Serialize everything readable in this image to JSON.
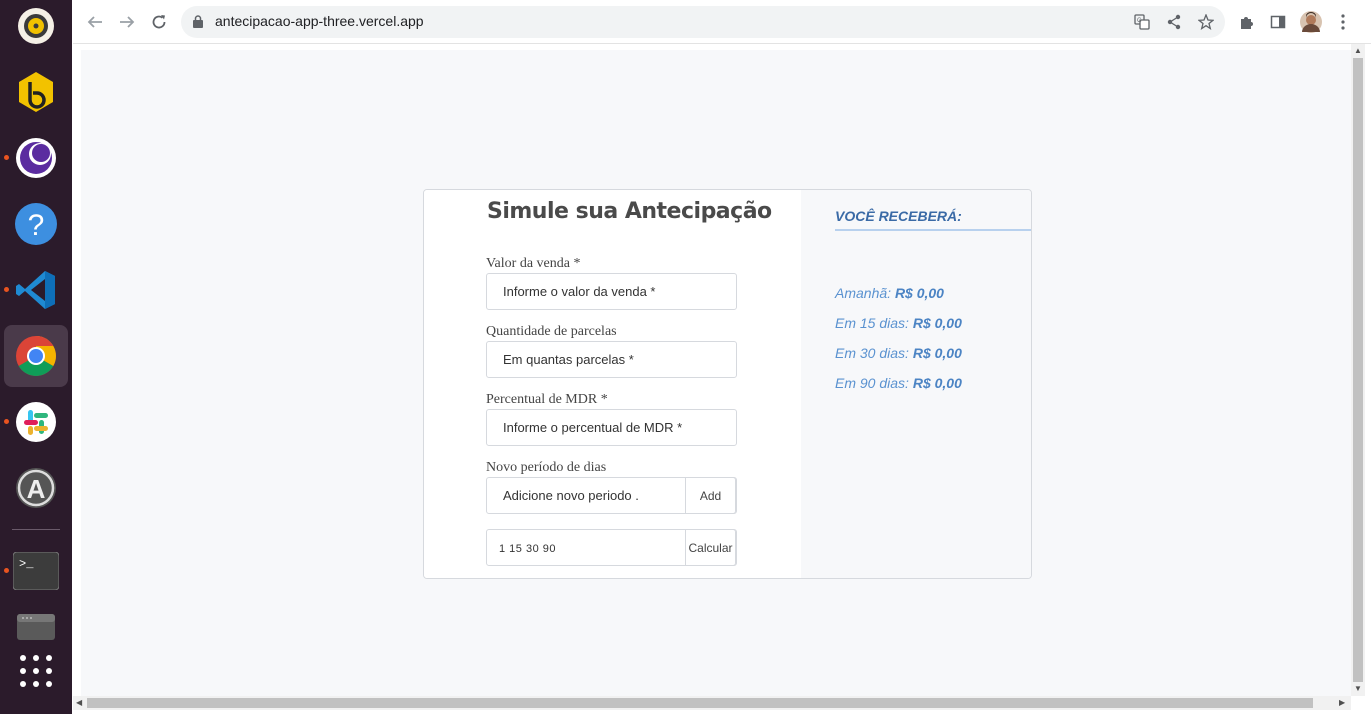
{
  "browser": {
    "url": "antecipacao-app-three.vercel.app"
  },
  "dock": {
    "apps": [
      "rhythmbox-icon",
      "bitwarden-icon",
      "firefox-nightly-icon",
      "help-icon",
      "vscode-icon",
      "chrome-icon",
      "slack-icon",
      "software-updater-icon",
      "terminal-icon",
      "files-icon",
      "app-grid-icon"
    ]
  },
  "form": {
    "title": "Simule sua Antecipação",
    "fields": [
      {
        "label": "Valor da venda *",
        "placeholder": "Informe o valor da venda *"
      },
      {
        "label": "Quantidade de parcelas",
        "placeholder": "Em quantas parcelas *"
      },
      {
        "label": "Percentual de MDR *",
        "placeholder": "Informe o percentual de MDR *"
      },
      {
        "label": "Novo período de dias",
        "placeholder": "Adicione novo periodo ."
      }
    ],
    "add_label": "Add",
    "periods_value": "1 15 30 90",
    "calculate_label": "Calcular"
  },
  "result": {
    "title": "VOCÊ RECEBERÁ:",
    "items": [
      {
        "label": "Amanhã:",
        "value": "R$ 0,00"
      },
      {
        "label": "Em 15 dias:",
        "value": "R$ 0,00"
      },
      {
        "label": "Em 30 dias:",
        "value": "R$ 0,00"
      },
      {
        "label": "Em 90 dias:",
        "value": "R$ 0,00"
      }
    ]
  },
  "colors": {
    "accent": "#3a6aa6",
    "result_text": "#5a92d0",
    "page_bg": "#f7f8fa"
  }
}
